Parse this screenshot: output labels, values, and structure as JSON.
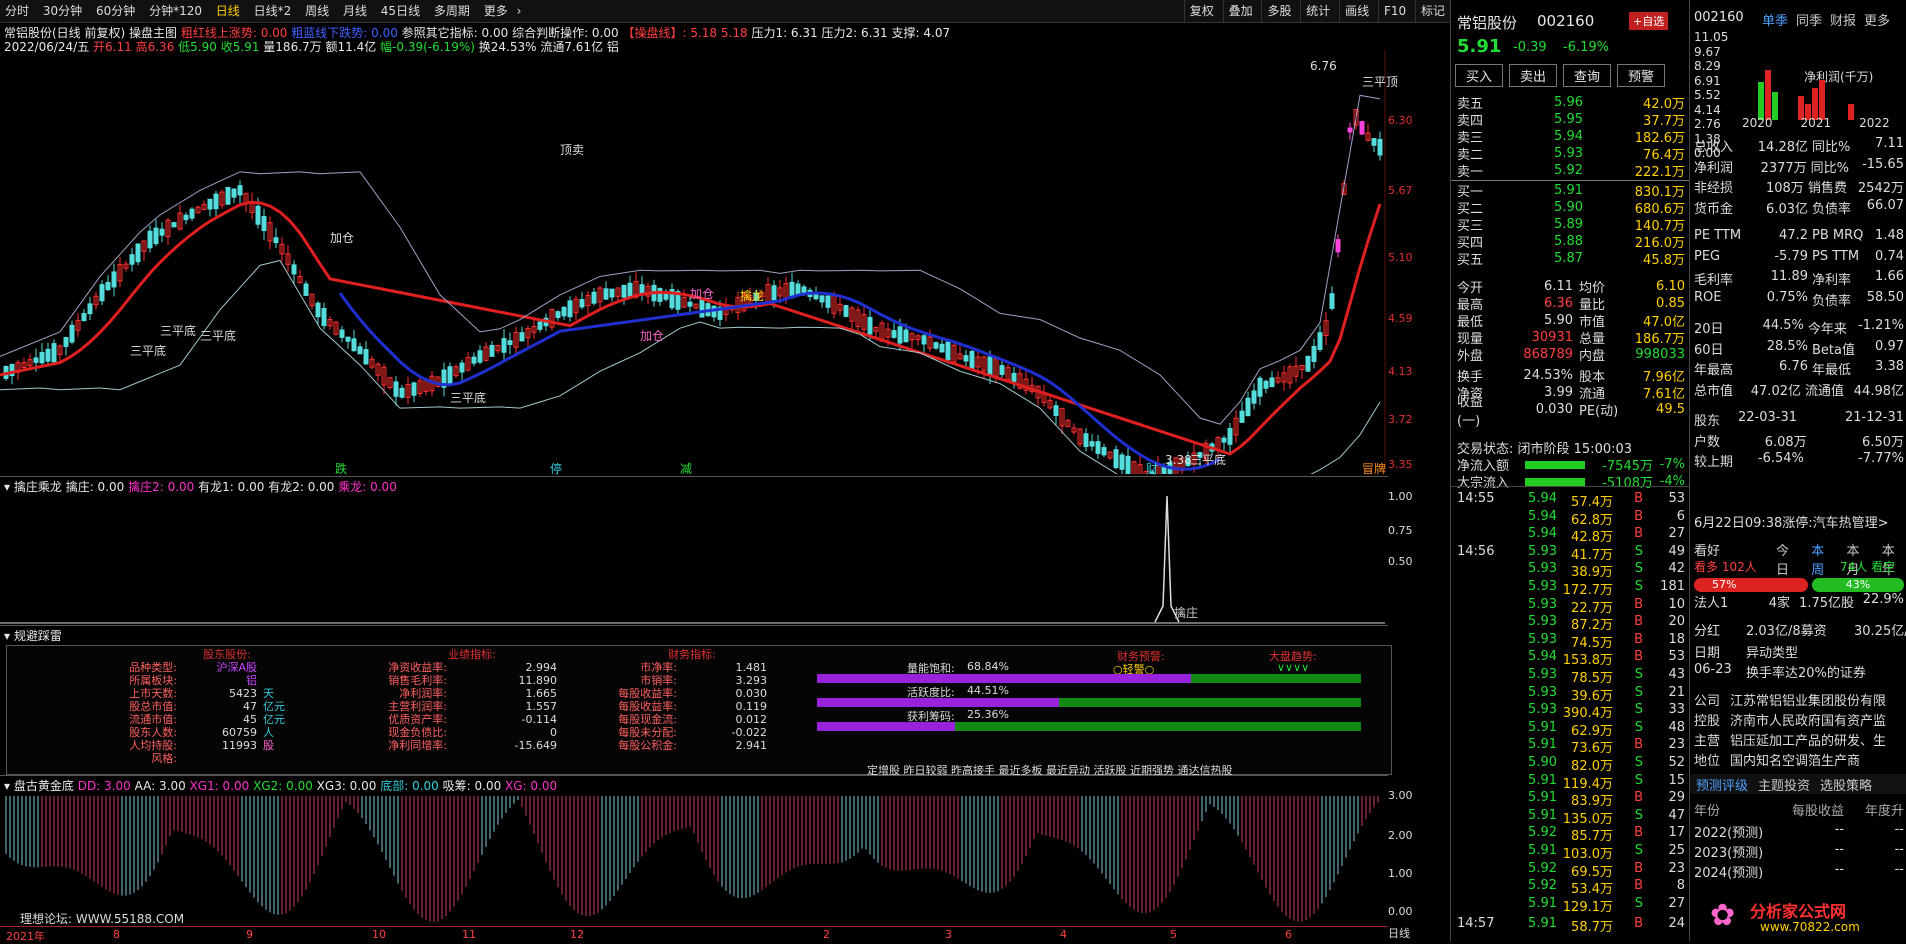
{
  "toolbar": {
    "tabs": [
      "分时",
      "30分钟",
      "60分钟",
      "分钟*120",
      "日线",
      "日线*2",
      "周线",
      "月线",
      "45日线",
      "多周期",
      "更多"
    ],
    "right": [
      "复权",
      "叠加",
      "多股",
      "统计",
      "画线",
      "F10",
      "标记"
    ]
  },
  "header": {
    "l1": [
      "常铝股份(日线 前复权)",
      "操盘主图",
      "粗红线上涨势: 0.00",
      "粗蓝线下跌势: 0.00",
      "参照其它指标: 0.00",
      "综合判断操作: 0.00",
      "【操盘线】: 5.18",
      "5.18",
      "压力1: 6.31",
      "压力2: 6.31",
      "支撑: 4.07"
    ],
    "l2": [
      "2022/06/24/五",
      "开6.11",
      "高6.36",
      "低5.90",
      "收5.91",
      "量186.7万",
      "额11.4亿",
      "幅-0.39(-6.19%)",
      "换24.53%",
      "流通7.61亿",
      "铝"
    ]
  },
  "price_axis": [
    "6.30",
    "5.67",
    "5.10",
    "4.59",
    "4.13",
    "3.72",
    "3.35"
  ],
  "main_annotations": [
    "6.76",
    "三平顶",
    "顶卖",
    "三平底",
    "三平底",
    "三平底",
    "三平底",
    "三平底",
    "3.38",
    "加仓",
    "加仓",
    "加仓",
    "擒龙",
    "跌",
    "停",
    "减",
    "财",
    "冒牌"
  ],
  "panel2": {
    "title": "擒庄乘龙",
    "items": [
      "擒庄: 0.00",
      "擒庄2: 0.00",
      "有龙1: 0.00",
      "有龙2: 0.00",
      "乘龙: 0.00"
    ],
    "axis": [
      "1.00",
      "0.75",
      "0.50"
    ],
    "mark": "擒庄"
  },
  "panel3": {
    "title": "规避踩雷"
  },
  "info": {
    "c1_title": "股东股份:",
    "c1": [
      [
        "品种类型:",
        "沪深A股",
        ""
      ],
      [
        "所属板块:",
        "铝",
        ""
      ],
      [
        "上市天数:",
        "5423",
        "天"
      ],
      [
        "股总市值:",
        "47",
        "亿元"
      ],
      [
        "流通市值:",
        "45",
        "亿元"
      ],
      [
        "股东人数:",
        "60759",
        "人"
      ],
      [
        "人均持股:",
        "11993",
        "股"
      ],
      [
        "风格:",
        "",
        ""
      ]
    ],
    "c2_title": "业绩指标:",
    "c2": [
      [
        "净资收益率:",
        "2.994"
      ],
      [
        "销售毛利率:",
        "11.890"
      ],
      [
        "净利润率:",
        "1.665"
      ],
      [
        "主营利润率:",
        "1.557"
      ],
      [
        "优质资产率:",
        "-0.114"
      ],
      [
        "现金负债比:",
        "0"
      ],
      [
        "净利同增率:",
        "-15.649"
      ]
    ],
    "c3_title": "财务指标:",
    "c3": [
      [
        "市净率:",
        "1.481"
      ],
      [
        "市销率:",
        "3.293"
      ],
      [
        "每股收益率:",
        "0.030"
      ],
      [
        "每股收益率:",
        "0.119"
      ],
      [
        "每股现金流:",
        "0.012"
      ],
      [
        "每股未分配:",
        "-0.022"
      ],
      [
        "每股公积金:",
        "2.941"
      ]
    ],
    "bars": [
      {
        "label": "量能饱和:",
        "value": "68.84%",
        "fill": 0.6884
      },
      {
        "label": "活跃度比:",
        "value": "44.51%",
        "fill": 0.4451
      },
      {
        "label": "获利筹码:",
        "value": "25.36%",
        "fill": 0.2536
      }
    ],
    "risk_title": "财务预警:",
    "risk_value": "○轻警○",
    "trend_title": "大盘趋势:",
    "trend_value": "∨∨∨∨",
    "footer": "定增股 昨日较弱 昨高接手 最近多板 最近异动 活跃股 近期强势 通达信热股"
  },
  "panel4": {
    "title": "盘古黄金底",
    "items": [
      "DD: 3.00",
      "AA: 3.00",
      "XG1: 0.00",
      "XG2: 0.00",
      "XG3: 0.00",
      "底部: 0.00",
      "吸筹: 0.00",
      "XG: 0.00"
    ],
    "axis": [
      "3.00",
      "2.00",
      "1.00",
      "0.00"
    ]
  },
  "xaxis": [
    "2021年",
    "8",
    "9",
    "10",
    "11",
    "12",
    "2",
    "3",
    "4",
    "5",
    "6"
  ],
  "watermark": "理想论坛: WWW.55188.COM",
  "bottom_tab": "日线",
  "quote": {
    "name": "常铝股份",
    "code": "002160",
    "add": "+自选",
    "price": "5.91",
    "chg": "-0.39",
    "pct": "-6.19%",
    "btns": [
      "买入",
      "卖出",
      "查询",
      "预警"
    ],
    "asks": [
      [
        "卖五",
        "5.96",
        "42.0万"
      ],
      [
        "卖四",
        "5.95",
        "37.7万"
      ],
      [
        "卖三",
        "5.94",
        "182.6万"
      ],
      [
        "卖二",
        "5.93",
        "76.4万"
      ],
      [
        "卖一",
        "5.92",
        "222.1万"
      ]
    ],
    "bids": [
      [
        "买一",
        "5.91",
        "830.1万"
      ],
      [
        "买二",
        "5.90",
        "680.6万"
      ],
      [
        "买三",
        "5.89",
        "140.7万"
      ],
      [
        "买四",
        "5.88",
        "216.0万"
      ],
      [
        "买五",
        "5.87",
        "45.8万"
      ]
    ],
    "stats": [
      [
        "今开",
        "6.11",
        "均价",
        "6.10"
      ],
      [
        "最高",
        "6.36",
        "量比",
        "0.85"
      ],
      [
        "最低",
        "5.90",
        "市值",
        "47.0亿"
      ],
      [
        "现量",
        "30931",
        "总量",
        "186.7万"
      ],
      [
        "外盘",
        "868789",
        "内盘",
        "998033"
      ],
      [
        "换手",
        "24.53%",
        "股本",
        "7.96亿"
      ],
      [
        "净资",
        "3.99",
        "流通",
        "7.61亿"
      ],
      [
        "收益(一)",
        "0.030",
        "PE(动)",
        "49.5"
      ]
    ],
    "status": "交易状态: 闭市阶段 15:00:03",
    "flows": [
      [
        "净流入额",
        "-7545万",
        "-7%"
      ],
      [
        "大宗流入",
        "-5108万",
        "-4%"
      ]
    ],
    "ticks": [
      [
        "14:55",
        "5.94",
        "57.4万",
        "B",
        "53"
      ],
      [
        "",
        "5.94",
        "62.8万",
        "B",
        "6"
      ],
      [
        "",
        "5.94",
        "42.8万",
        "B",
        "27"
      ],
      [
        "14:56",
        "5.93",
        "41.7万",
        "S",
        "49"
      ],
      [
        "",
        "5.93",
        "38.9万",
        "S",
        "42"
      ],
      [
        "",
        "5.93",
        "172.7万",
        "S",
        "181"
      ],
      [
        "",
        "5.93",
        "22.7万",
        "B",
        "10"
      ],
      [
        "",
        "5.93",
        "87.2万",
        "B",
        "20"
      ],
      [
        "",
        "5.93",
        "74.5万",
        "B",
        "18"
      ],
      [
        "",
        "5.94",
        "153.8万",
        "B",
        "53"
      ],
      [
        "",
        "5.93",
        "78.5万",
        "S",
        "43"
      ],
      [
        "",
        "5.93",
        "39.6万",
        "S",
        "21"
      ],
      [
        "",
        "5.93",
        "390.4万",
        "S",
        "33"
      ],
      [
        "",
        "5.91",
        "62.9万",
        "S",
        "48"
      ],
      [
        "",
        "5.91",
        "73.6万",
        "B",
        "23"
      ],
      [
        "",
        "5.90",
        "82.0万",
        "S",
        "52"
      ],
      [
        "",
        "5.91",
        "119.4万",
        "S",
        "15"
      ],
      [
        "",
        "5.91",
        "83.9万",
        "B",
        "29"
      ],
      [
        "",
        "5.91",
        "135.0万",
        "S",
        "47"
      ],
      [
        "",
        "5.92",
        "85.7万",
        "B",
        "17"
      ],
      [
        "",
        "5.91",
        "103.0万",
        "S",
        "25"
      ],
      [
        "",
        "5.92",
        "69.5万",
        "B",
        "23"
      ],
      [
        "",
        "5.92",
        "53.4万",
        "B",
        "8"
      ],
      [
        "",
        "5.91",
        "129.1万",
        "S",
        "27"
      ],
      [
        "14:57",
        "5.91",
        "58.7万",
        "B",
        "24"
      ]
    ]
  },
  "fund": {
    "code": "002160",
    "tabs": [
      "单季",
      "同季",
      "财报",
      "更多"
    ],
    "axis": [
      "11.05",
      "9.67",
      "8.29",
      "6.91",
      "5.52",
      "4.14",
      "2.76",
      "1.38",
      "0.00"
    ],
    "chart_title": "净利润(千万)",
    "years": [
      "2020",
      "2021",
      "2022"
    ],
    "rows": [
      [
        "总收入",
        "14.28亿",
        "同比%",
        "7.11"
      ],
      [
        "净利润",
        "2377万",
        "同比%",
        "-15.65"
      ],
      [
        "非经损",
        "108万",
        "销售费",
        "2542万"
      ],
      [
        "货币金",
        "6.03亿",
        "负债率",
        "66.07"
      ],
      [
        "PE TTM",
        "47.2",
        "PB MRQ",
        "1.48"
      ],
      [
        "PEG",
        "-5.79",
        "PS TTM",
        "0.74"
      ],
      [
        "毛利率",
        "11.89",
        "净利率",
        "1.66"
      ],
      [
        "ROE",
        "0.75%",
        "负债率",
        "58.50"
      ],
      [
        "20日",
        "44.5%",
        "今年来",
        "-1.21%"
      ],
      [
        "60日",
        "28.5%",
        "Beta值",
        "0.97"
      ],
      [
        "年最高",
        "6.76",
        "年最低",
        "3.38"
      ],
      [
        "总市值",
        "47.02亿",
        "流通值",
        "44.98亿"
      ],
      [
        "股东",
        "22-03-31",
        "",
        "21-12-31"
      ],
      [
        "户数",
        "6.08万",
        "",
        "6.50万"
      ],
      [
        "较上期",
        "-6.54%",
        "",
        "-7.77%"
      ]
    ],
    "news": "6月22日09:38涨停:汽车热管理>",
    "sentiment": {
      "title": "看好",
      "period": [
        "今日",
        "本周",
        "本月",
        "本年"
      ],
      "bull": "看多 102人",
      "bear": "74人 看空",
      "bull_pct": "57%",
      "bear_pct": "43%"
    },
    "inst": [
      [
        "法人1",
        "4家",
        "1.75亿股",
        "22.9%"
      ],
      [
        "分红",
        "2.03亿/8募资",
        "",
        "30.25亿/2"
      ]
    ],
    "events": [
      [
        "日期",
        "异动类型"
      ],
      [
        "06-23",
        "换手率达20%的证券"
      ]
    ],
    "company": [
      [
        "公司",
        "江苏常铝铝业集团股份有限"
      ],
      [
        "控股",
        "济南市人民政府国有资产监"
      ],
      [
        "主营",
        "铝压延加工产品的研发、生"
      ],
      [
        "地位",
        "国内知名空调箔生产商"
      ]
    ],
    "tabs2": [
      "预测评级",
      "主题投资",
      "选股策略"
    ],
    "forecast_head": [
      "年份",
      "每股收益",
      "年度升"
    ],
    "forecast": [
      [
        "2022(预测)",
        "--",
        "--"
      ],
      [
        "2023(预测)",
        "--",
        "--"
      ],
      [
        "2024(预测)",
        "--",
        "--"
      ]
    ]
  },
  "logo": {
    "text": "分析家公式网",
    "url": "www.70822.com"
  }
}
